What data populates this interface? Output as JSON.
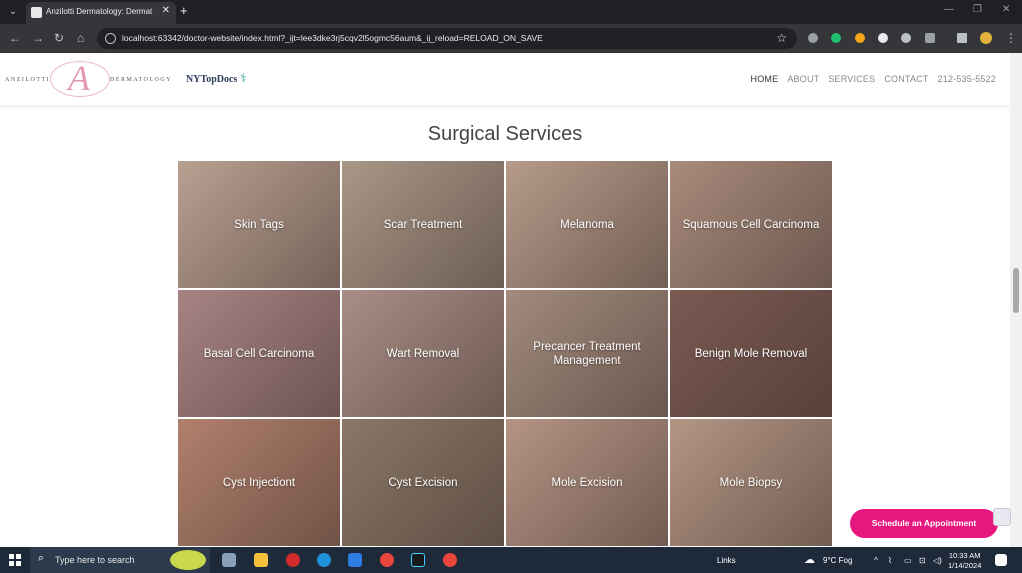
{
  "browser": {
    "tab_title": "Anzilotti Dermatology: Dermat",
    "url": "localhost:63342/doctor-website/index.html?_ijt=lee3dke3rj5cqv2l5ogmc56aum&_ij_reload=RELOAD_ON_SAVE"
  },
  "header": {
    "logo_left": "ANZILOTTI",
    "logo_monogram": "A",
    "logo_right": "DERMATOLOGY",
    "partner_logo": "NYTopDocs",
    "nav": [
      {
        "label": "HOME"
      },
      {
        "label": "ABOUT"
      },
      {
        "label": "SERVICES"
      },
      {
        "label": "CONTACT"
      },
      {
        "label": "212-535-5522"
      }
    ]
  },
  "main": {
    "section_title": "Surgical Services",
    "services": [
      {
        "label": "Skin Tags",
        "bg": "#b9a191"
      },
      {
        "label": "Scar Treatment",
        "bg": "#a99787"
      },
      {
        "label": "Melanoma",
        "bg": "#b69b8a"
      },
      {
        "label": "Squamous Cell Carcinoma",
        "bg": "#a88b7c"
      },
      {
        "label": "Basal Cell Carcinoma",
        "bg": "#a88484"
      },
      {
        "label": "Wart Removal",
        "bg": "#a98e86"
      },
      {
        "label": "Precancer Treatment Management",
        "bg": "#a28b7d"
      },
      {
        "label": "Benign Mole Removal",
        "bg": "#7a5a52"
      },
      {
        "label": "Cyst Injectiont",
        "bg": "#b1806c"
      },
      {
        "label": "Cyst Excision",
        "bg": "#8a7766"
      },
      {
        "label": "Mole Excision",
        "bg": "#b59484"
      },
      {
        "label": "Mole Biopsy",
        "bg": "#b49684"
      }
    ],
    "cta_label": "Schedule an Appointment"
  },
  "taskbar": {
    "search_placeholder": "Type here to search",
    "links_label": "Links",
    "weather": "9°C Fog",
    "time": "10:33 AM",
    "date": "1/14/2024"
  },
  "colors": {
    "accent": "#e6177f",
    "logo_pink": "#e39ab3"
  }
}
